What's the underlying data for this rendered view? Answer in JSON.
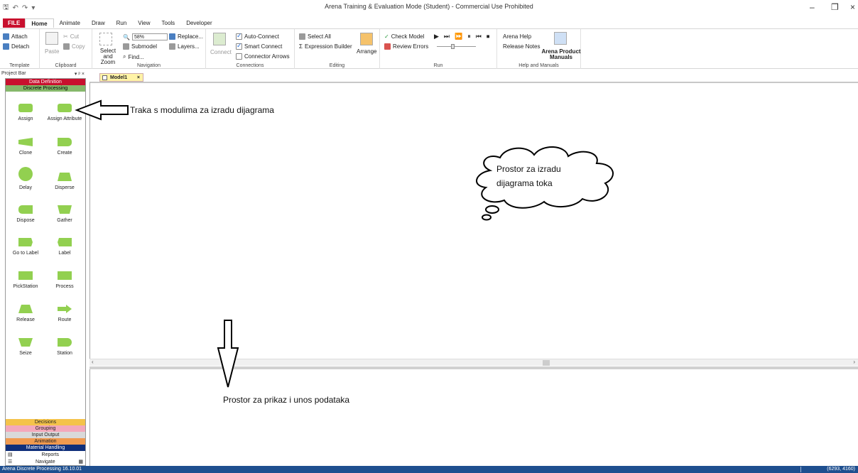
{
  "window": {
    "title": "Arena Training & Evaluation Mode (Student) - Commercial Use Prohibited",
    "minimize": "–",
    "restore": "❐",
    "close": "×"
  },
  "ribbon_tabs": [
    "FILE",
    "Home",
    "Animate",
    "Draw",
    "Run",
    "View",
    "Tools",
    "Developer"
  ],
  "ribbon": {
    "template": {
      "attach": "Attach",
      "detach": "Detach",
      "label": "Template"
    },
    "clipboard": {
      "paste": "Paste",
      "cut": "Cut",
      "copy": "Copy",
      "label": "Clipboard"
    },
    "navigation": {
      "zoom_value": "58%",
      "replace": "Replace...",
      "submodel": "Submodel",
      "layers": "Layers...",
      "find": "Find...",
      "select_zoom": "Select and Zoom",
      "label": "Navigation"
    },
    "connections": {
      "connect": "Connect",
      "auto_connect": "Auto-Connect",
      "smart_connect": "Smart Connect",
      "connector_arrows": "Connector Arrows",
      "label": "Connections"
    },
    "editing": {
      "select_all": "Select All",
      "expression_builder": "Expression Builder",
      "arrange": "Arrange",
      "label": "Editing"
    },
    "run": {
      "check_model": "Check Model",
      "review_errors": "Review Errors",
      "label": "Run"
    },
    "help": {
      "arena_help": "Arena Help",
      "release_notes": "Release Notes",
      "manuals": "Arena Product Manuals",
      "label": "Help and Manuals"
    }
  },
  "project_bar": {
    "title": "Project Bar",
    "controls": "▾ ᵖ ×",
    "top_panels": [
      "Data Definition",
      "Discrete Processing"
    ],
    "modules": [
      "Assign",
      "Assign Attribute",
      "Clone",
      "Create",
      "Delay",
      "Disperse",
      "Dispose",
      "Gather",
      "Go to Label",
      "Label",
      "PickStation",
      "Process",
      "Release",
      "Route",
      "Seize",
      "Station"
    ],
    "bottom_panels": [
      "Decisions",
      "Grouping",
      "Input Output",
      "Animation",
      "Material Handling"
    ],
    "reports": "Reports",
    "navigate": "Navigate"
  },
  "model_tab": {
    "label": "Model1",
    "close": "×"
  },
  "annotations": {
    "modules_bar": "Traka s modulima za izradu dijagrama",
    "cloud_line1": "Prostor za izradu",
    "cloud_line2": "dijagrama toka",
    "data_area": "Prostor za prikaz i unos podataka"
  },
  "status": {
    "left": "Arena Discrete Processing 16.10.01",
    "right": "(6293, 4160)"
  }
}
